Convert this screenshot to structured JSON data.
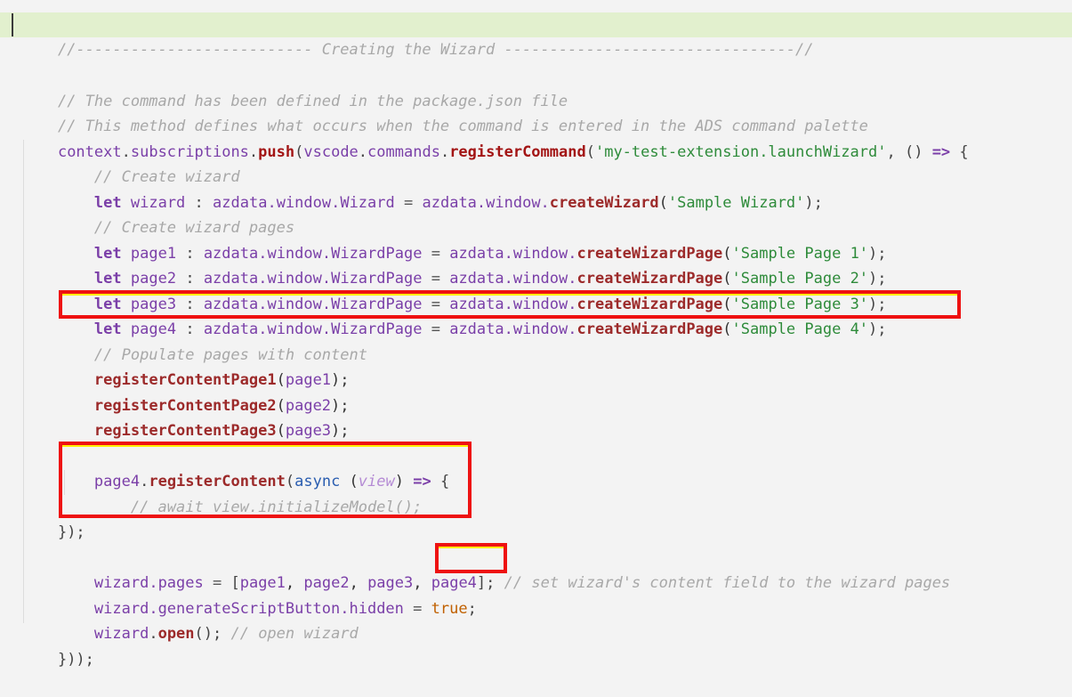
{
  "editor": {
    "background_color": "#f3f3f3",
    "highlight_color": "#e2f0ce",
    "annotation_color": "#ee1111",
    "annotation_inner_color": "#ffee00",
    "font_size_px": 17,
    "line_height_px": 28.1,
    "colors": {
      "comment": "#a8a8a8",
      "identifier": "#7a3fa8",
      "method": "#a31515",
      "string": "#2e8b3a",
      "keyword_blue": "#2a5db0",
      "parameter": "#b48ad4",
      "boolean": "#c06000",
      "punctuation": "#444444"
    }
  },
  "banner": {
    "text": "//-------------------------- Creating the Wizard --------------------------------//",
    "title": "Creating the Wizard"
  },
  "code": {
    "lines": [
      {
        "id": "line-1-banner",
        "kind": "banner-comment",
        "raw": "//-------------------------- Creating the Wizard --------------------------------//"
      },
      {
        "id": "line-2-blank",
        "kind": "blank",
        "raw": ""
      },
      {
        "id": "line-3-comment",
        "kind": "comment",
        "raw": "// The command has been defined in the package.json file"
      },
      {
        "id": "line-4-comment",
        "kind": "comment",
        "raw": "// This method defines what occurs when the command is entered in the ADS command palette"
      },
      {
        "id": "line-5-register-command",
        "kind": "code",
        "raw": "context.subscriptions.push(vscode.commands.registerCommand('my-test-extension.launchWizard', () => {"
      },
      {
        "id": "line-6-comment",
        "kind": "comment",
        "raw": "    // Create wizard"
      },
      {
        "id": "line-7-let-wizard",
        "kind": "code",
        "raw": "    let wizard : azdata.window.Wizard = azdata.window.createWizard('Sample Wizard');"
      },
      {
        "id": "line-8-comment",
        "kind": "comment",
        "raw": "    // Create wizard pages"
      },
      {
        "id": "line-9-let-page1",
        "kind": "code",
        "raw": "    let page1 : azdata.window.WizardPage = azdata.window.createWizardPage('Sample Page 1');"
      },
      {
        "id": "line-10-let-page2",
        "kind": "code",
        "raw": "    let page2 : azdata.window.WizardPage = azdata.window.createWizardPage('Sample Page 2');"
      },
      {
        "id": "line-11-let-page3",
        "kind": "code",
        "raw": "    let page3 : azdata.window.WizardPage = azdata.window.createWizardPage('Sample Page 3');"
      },
      {
        "id": "line-12-let-page4",
        "kind": "code",
        "highlighted": true,
        "raw": "    let page4 : azdata.window.WizardPage = azdata.window.createWizardPage('Sample Page 4');"
      },
      {
        "id": "line-13-comment",
        "kind": "comment",
        "raw": "    // Populate pages with content"
      },
      {
        "id": "line-14-register-page1",
        "kind": "code",
        "raw": "    registerContentPage1(page1);"
      },
      {
        "id": "line-15-register-page2",
        "kind": "code",
        "raw": "    registerContentPage2(page2);"
      },
      {
        "id": "line-16-register-page3",
        "kind": "code",
        "raw": "    registerContentPage3(page3);"
      },
      {
        "id": "line-17-blank",
        "kind": "blank",
        "raw": ""
      },
      {
        "id": "line-18-register-content",
        "kind": "code",
        "highlighted": true,
        "raw": "    page4.registerContent(async (view) => {"
      },
      {
        "id": "line-19-comment",
        "kind": "comment",
        "highlighted": true,
        "raw": "        // await view.initializeModel();"
      },
      {
        "id": "line-20-close",
        "kind": "code",
        "highlighted": true,
        "raw": "    });"
      },
      {
        "id": "line-21-blank",
        "kind": "blank",
        "raw": ""
      },
      {
        "id": "line-22-wizard-pages",
        "kind": "code",
        "highlighted": true,
        "raw": "    wizard.pages = [page1, page2, page3, page4]; // set wizard's content field to the wizard pages"
      },
      {
        "id": "line-23-generate-script",
        "kind": "code",
        "raw": "    wizard.generateScriptButton.hidden = true;"
      },
      {
        "id": "line-24-open",
        "kind": "code",
        "raw": "    wizard.open(); // open wizard"
      },
      {
        "id": "line-25-end",
        "kind": "code",
        "raw": "}));"
      }
    ]
  },
  "tokens": {
    "line5": {
      "context": "context",
      "dot1": ".",
      "subscriptions": "subscriptions",
      "dot2": ".",
      "push": "push",
      "paren_open": "(",
      "vscode": "vscode",
      "dot3": ".",
      "commands": "commands",
      "dot4": ".",
      "registerCommand": "registerCommand",
      "paren_open2": "(",
      "string": "'my-test-extension.launchWizard'",
      "comma": ", ",
      "parens": "() ",
      "arrow": "=>",
      "brace": " {"
    },
    "line7": {
      "let": "let",
      "name": "wizard",
      "colon": ":",
      "type": "azdata.window.Wizard",
      "equals": "=",
      "obj": "azdata.window.",
      "call": "createWizard",
      "string": "'Sample Wizard'",
      "tail": ");"
    },
    "line9": {
      "name": "page1",
      "type": "azdata.window.WizardPage",
      "call": "createWizardPage",
      "string": "'Sample Page 1'"
    },
    "line10": {
      "name": "page2",
      "type": "azdata.window.WizardPage",
      "call": "createWizardPage",
      "string": "'Sample Page 2'"
    },
    "line11": {
      "name": "page3",
      "type": "azdata.window.WizardPage",
      "call": "createWizardPage",
      "string": "'Sample Page 3'"
    },
    "line12": {
      "name": "page4",
      "type": "azdata.window.WizardPage",
      "call": "createWizardPage",
      "string": "'Sample Page 4'"
    },
    "line14": {
      "call": "registerContentPage1",
      "arg": "page1"
    },
    "line15": {
      "call": "registerContentPage2",
      "arg": "page2"
    },
    "line16": {
      "call": "registerContentPage3",
      "arg": "page3"
    },
    "line18": {
      "obj": "page4",
      "dot": ".",
      "call": "registerContent",
      "paren": "(",
      "async": "async",
      "view": "view",
      "arrow": "=>",
      "brace": "{"
    },
    "line19": {
      "comment": "// await view.initializeModel();"
    },
    "line20": {
      "close": "});"
    },
    "line22": {
      "obj": "wizard",
      "prop": ".pages ",
      "equals": "=",
      "bracket_open": " [",
      "p1": "page1",
      "p2": "page2",
      "p3": "page3",
      "p4": "page4",
      "bracket_close": "];",
      "comment": "// set wizard's content field to the wizard pages"
    },
    "line23": {
      "obj": "wizard",
      "prop": ".generateScriptButton.hidden ",
      "equals": "=",
      "value": "true",
      "semi": ";"
    },
    "line24": {
      "obj": "wizard",
      "dot": ".",
      "call": "open",
      "tail": "(); ",
      "comment": "// open wizard"
    },
    "line25": {
      "text": "}));"
    }
  },
  "annotations": [
    {
      "id": "annotation-page4-declaration",
      "label": "red-box-around-let-page4-line"
    },
    {
      "id": "annotation-register-content-block",
      "label": "red-box-around-page4-registerContent-block"
    },
    {
      "id": "annotation-page4-in-pages-array",
      "label": "red-box-around-page4-in-pages-array"
    }
  ],
  "caret": {
    "id": "text-caret",
    "line": 1
  }
}
